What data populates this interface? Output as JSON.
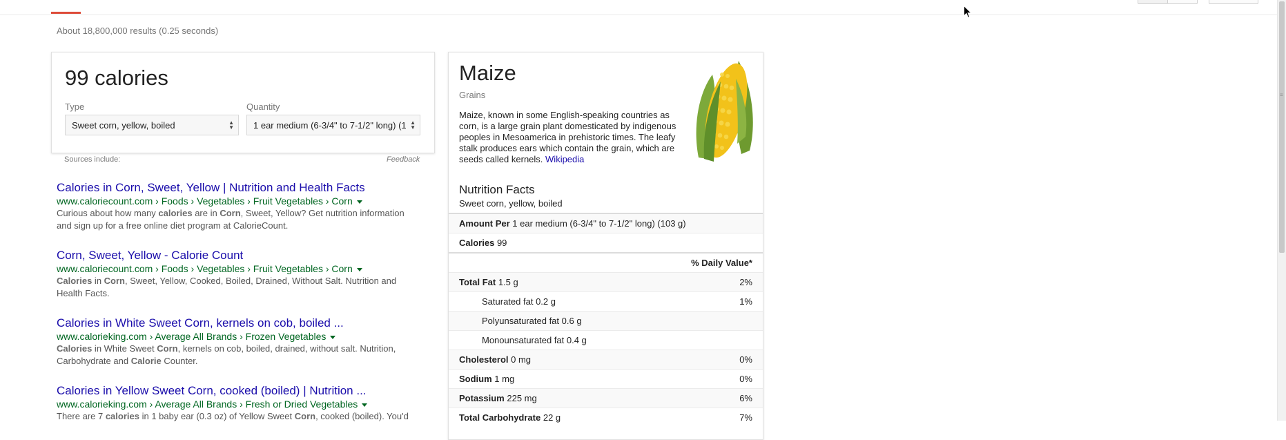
{
  "header": {
    "result_stats": "About 18,800,000 results (0.25 seconds)"
  },
  "calculator": {
    "title": "99 calories",
    "type_label": "Type",
    "type_value": "Sweet corn, yellow, boiled",
    "quantity_label": "Quantity",
    "quantity_value": "1 ear medium (6-3/4\" to 7-1/2\" long) (1",
    "sources_label": "Sources include:",
    "feedback_label": "Feedback"
  },
  "results": [
    {
      "title": "Calories in Corn, Sweet, Yellow | Nutrition and Health Facts",
      "url": "www.caloriecount.com › Foods › Vegetables › Fruit Vegetables › Corn",
      "snippet_html": "Curious about how many <b>calories</b> are in <b>Corn</b>, Sweet, Yellow? Get nutrition information and sign up for a free online diet program at CalorieCount."
    },
    {
      "title": "Corn, Sweet, Yellow - Calorie Count",
      "url": "www.caloriecount.com › Foods › Vegetables › Fruit Vegetables › Corn",
      "snippet_html": "<b>Calories</b> in <b>Corn</b>, Sweet, Yellow, Cooked, Boiled, Drained, Without Salt. Nutrition and Health Facts."
    },
    {
      "title": "Calories in White Sweet Corn, kernels on cob, boiled ...",
      "url": "www.calorieking.com › Average All Brands › Frozen Vegetables",
      "snippet_html": "<b>Calories</b> in White Sweet <b>Corn</b>, kernels on cob, boiled, drained, without salt. Nutrition, Carbohydrate and <b>Calorie</b> Counter."
    },
    {
      "title": "Calories in Yellow Sweet Corn, cooked (boiled) | Nutrition ...",
      "url": "www.calorieking.com › Average All Brands › Fresh or Dried Vegetables",
      "snippet_html": "There are 7 <b>calories</b> in 1 baby ear (0.3 oz) of Yellow Sweet <b>Corn</b>, cooked (boiled). You'd"
    }
  ],
  "knowledge_panel": {
    "title": "Maize",
    "subtitle": "Grains",
    "description": "Maize, known in some English-speaking countries as corn, is a large grain plant domesticated by indigenous peoples in Mesoamerica in prehistoric times. The leafy stalk produces ears which contain the grain, which are seeds called kernels.",
    "wiki_link": "Wikipedia",
    "image_icon": "corn-cob",
    "nutrition": {
      "title": "Nutrition Facts",
      "subtitle": "Sweet corn, yellow, boiled",
      "amount_label": "Amount Per",
      "amount_value": "1 ear medium (6-3/4\" to 7-1/2\" long) (103 g)",
      "calories_label": "Calories",
      "calories_value": "99",
      "dv_header": "% Daily Value*",
      "total_fat_label": "Total Fat",
      "total_fat_value": "1.5 g",
      "total_fat_dv": "2%",
      "sat_fat_label": "Saturated fat",
      "sat_fat_value": "0.2 g",
      "sat_fat_dv": "1%",
      "poly_fat_label": "Polyunsaturated fat",
      "poly_fat_value": "0.6 g",
      "mono_fat_label": "Monounsaturated fat",
      "mono_fat_value": "0.4 g",
      "cholesterol_label": "Cholesterol",
      "cholesterol_value": "0 mg",
      "cholesterol_dv": "0%",
      "sodium_label": "Sodium",
      "sodium_value": "1 mg",
      "sodium_dv": "0%",
      "potassium_label": "Potassium",
      "potassium_value": "225 mg",
      "potassium_dv": "6%",
      "carb_label": "Total Carbohydrate",
      "carb_value": "22 g",
      "carb_dv": "7%"
    }
  },
  "colors": {
    "link": "#1a0dab",
    "url": "#006621",
    "tab_accent": "#dd4b39"
  }
}
